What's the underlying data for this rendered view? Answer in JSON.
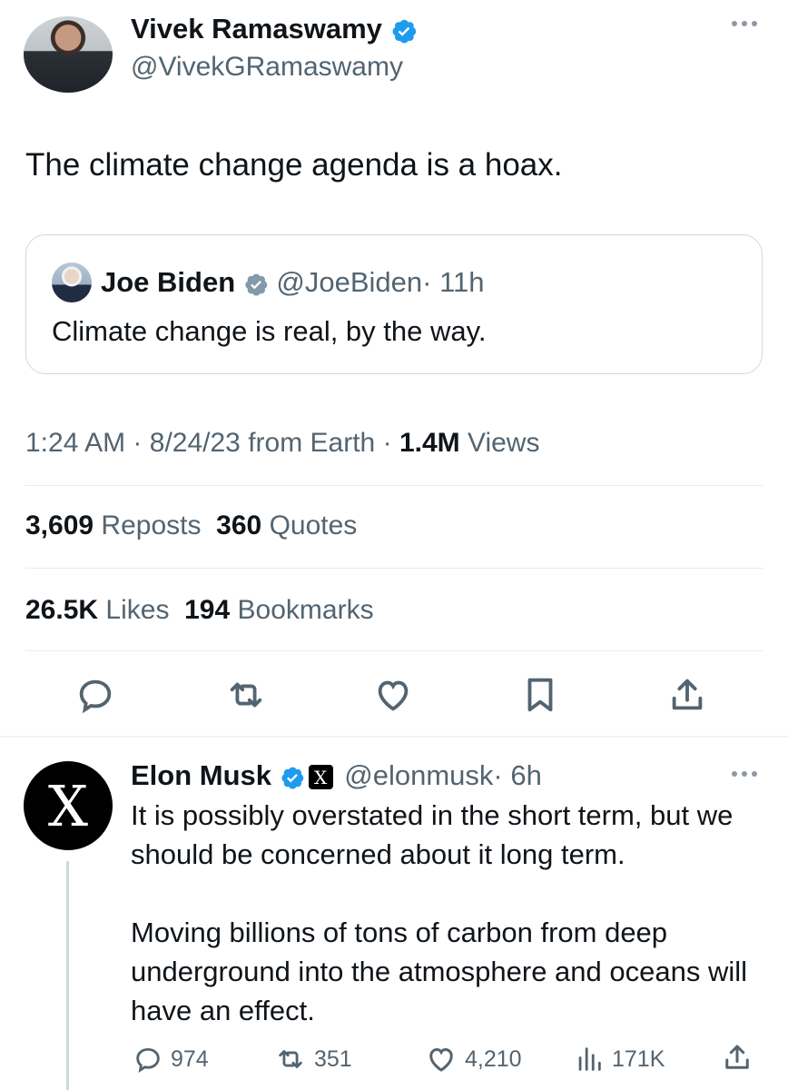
{
  "tweet": {
    "author_name": "Vivek Ramaswamy",
    "author_handle": "@VivekGRamaswamy",
    "text": "The climate change agenda is a hoax.",
    "quoted": {
      "author_name": "Joe Biden",
      "author_handle": "@JoeBiden",
      "time": "· 11h",
      "text": "Climate change is real, by the way."
    },
    "meta": {
      "time": "1:24 AM",
      "dot1": "·",
      "date": "8/24/23",
      "source": "from Earth",
      "dot2": "·",
      "views_count": "1.4M",
      "views_label": "Views"
    },
    "stats": {
      "reposts_count": "3,609",
      "reposts_label": "Reposts",
      "quotes_count": "360",
      "quotes_label": "Quotes",
      "likes_count": "26.5K",
      "likes_label": "Likes",
      "bookmarks_count": "194",
      "bookmarks_label": "Bookmarks"
    },
    "actions": [
      "reply-icon",
      "repost-icon",
      "like-icon",
      "bookmark-icon",
      "share-icon"
    ]
  },
  "reply": {
    "author_name": "Elon Musk",
    "badge": "X",
    "author_handle": "@elonmusk",
    "time": "· 6h",
    "avatar_glyph": "X",
    "paragraphs": [
      "It is possibly overstated in the short term, but we should be concerned about it long term.",
      "Moving billions of tons of carbon from deep underground into the atmosphere and oceans will have an effect."
    ],
    "counts": {
      "replies": "974",
      "reposts": "351",
      "likes": "4,210",
      "views": "171K"
    }
  },
  "colors": {
    "verified_blue": "#1d9bf0",
    "text": "#0f1419",
    "muted": "#536471",
    "border": "#cfd9de"
  }
}
